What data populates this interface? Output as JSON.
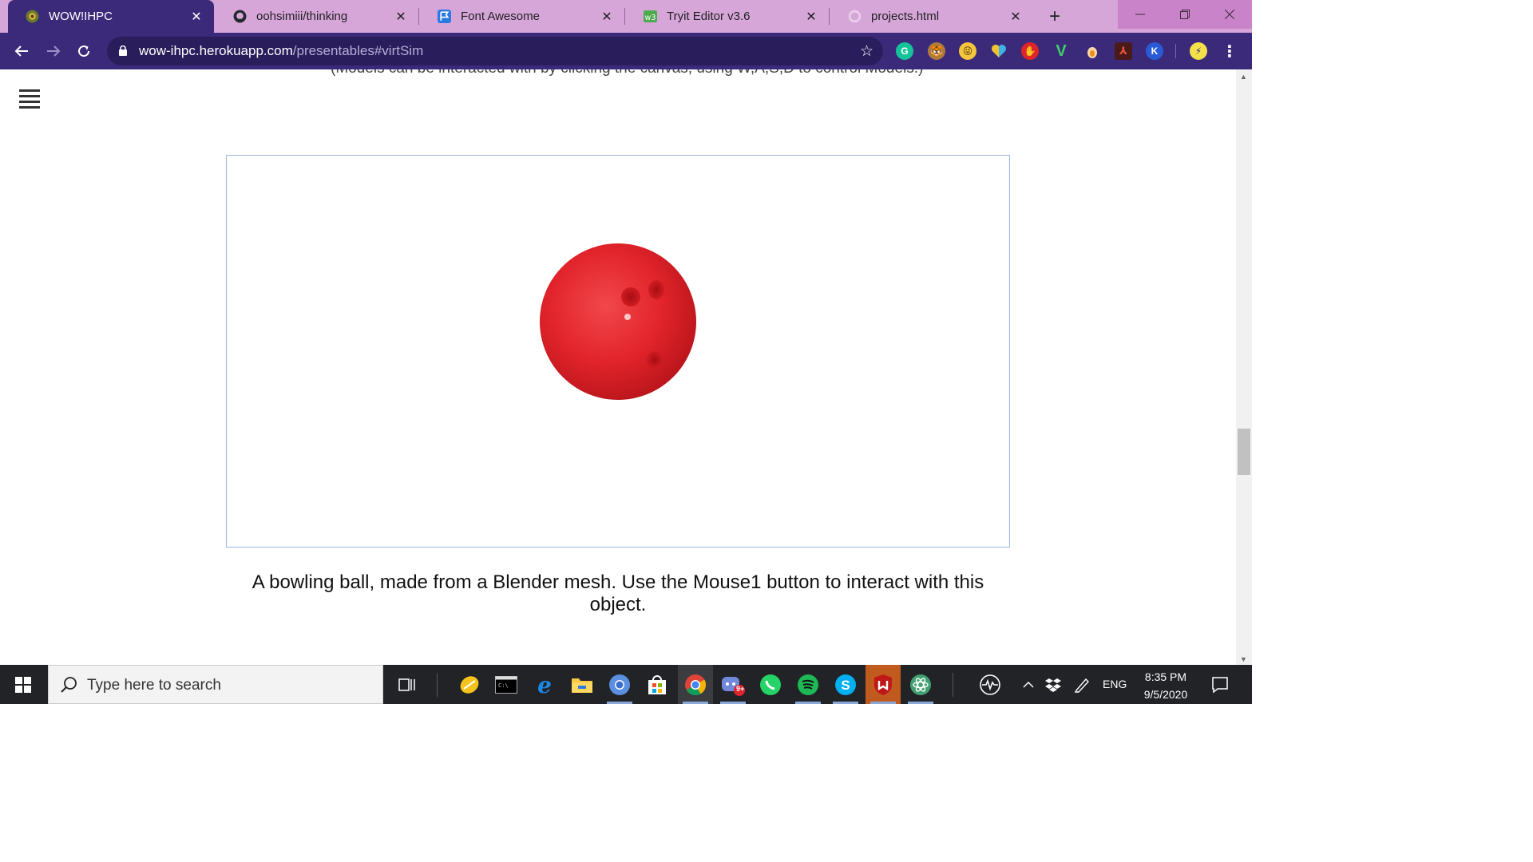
{
  "browser": {
    "tabs": [
      {
        "title": "WOW!IHPC",
        "active": true
      },
      {
        "title": "oohsimiii/thinking",
        "active": false
      },
      {
        "title": "Font Awesome",
        "active": false
      },
      {
        "title": "Tryit Editor v3.6",
        "active": false
      },
      {
        "title": "projects.html",
        "active": false
      }
    ],
    "new_tab_label": "+",
    "close_label": "✕",
    "url_domain": "wow-ihpc.herokuapp.com",
    "url_path": "/presentables#virtSim",
    "accent_color": "#3b2a7a",
    "tabstrip_color": "#d7a6d8"
  },
  "page": {
    "cut_off_text": "(Models can be interacted with by clicking the canvas, using W,A,S,D to control Models.)",
    "caption": "A bowling ball, made from a Blender mesh. Use the Mouse1 button to interact with this object.",
    "ball_color": "#e2242b"
  },
  "taskbar": {
    "search_placeholder": "Type here to search",
    "language": "ENG",
    "time": "8:35 PM",
    "date": "9/5/2020",
    "notification_badge": "9+"
  }
}
